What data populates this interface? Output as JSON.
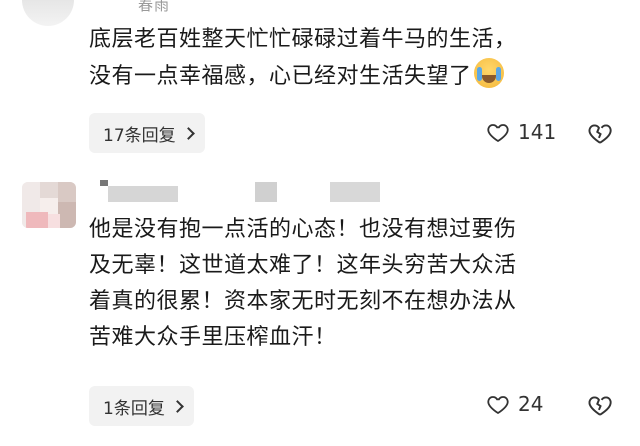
{
  "top": {
    "username": "春雨"
  },
  "comments": [
    {
      "text": "底层老百姓整天忙忙碌碌过着牛马的生活，\n没有一点幸福感，心已经对生活失望了",
      "emoji": "crying-face-icon",
      "reply_label": "17条回复",
      "likes": "141"
    },
    {
      "text": "他是没有抱一点活的心态！也没有想过要伤\n及无辜！这世道太难了！这年头穷苦大众活\n着真的很累！资本家无时无刻不在想办法从\n苦难大众手里压榨血汗！",
      "reply_label": "1条回复",
      "likes": "24"
    }
  ],
  "colors": {
    "text": "#1a1a1a",
    "pill_bg": "#f2f2f2",
    "icon": "#333333"
  }
}
